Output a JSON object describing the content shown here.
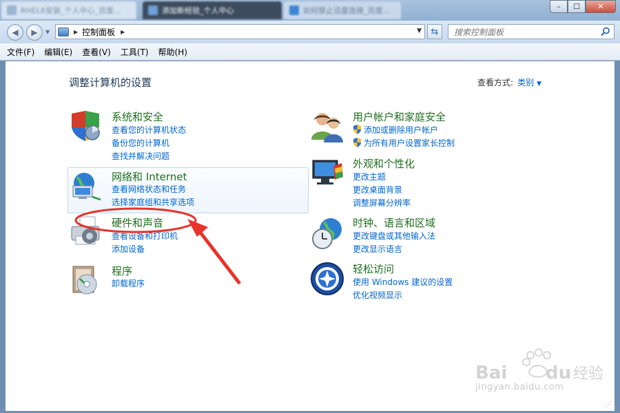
{
  "tabs": [
    {
      "label": "RHEL6安装_个人中心_百度..."
    },
    {
      "label": "添加新经验_个人中心"
    },
    {
      "label": "如何禁止迅雷连接_百度..."
    }
  ],
  "window": {
    "min": "–",
    "max": "☐",
    "close": "✕"
  },
  "address": {
    "crumb": "控制面板",
    "search_placeholder": "搜索控制面板"
  },
  "menu": [
    "文件(F)",
    "编辑(E)",
    "查看(V)",
    "工具(T)",
    "帮助(H)"
  ],
  "main": {
    "title": "调整计算机的设置",
    "view_by_label": "查看方式:",
    "view_by_value": "类别"
  },
  "categories": [
    {
      "title": "系统和安全",
      "links": [
        "查看您的计算机状态",
        "备份您的计算机",
        "查找并解决问题"
      ],
      "icon": "shield-icon"
    },
    {
      "title": "网络和 Internet",
      "links": [
        "查看网络状态和任务",
        "选择家庭组和共享选项"
      ],
      "icon": "network-icon"
    },
    {
      "title": "硬件和声音",
      "links": [
        "查看设备和打印机",
        "添加设备"
      ],
      "icon": "printer-icon"
    },
    {
      "title": "程序",
      "links": [
        "卸载程序"
      ],
      "icon": "programs-icon"
    },
    {
      "title": "用户帐户和家庭安全",
      "links": [
        "添加或删除用户帐户",
        "为所有用户设置家长控制"
      ],
      "icon": "users-icon"
    },
    {
      "title": "外观和个性化",
      "links": [
        "更改主题",
        "更改桌面背景",
        "调整屏幕分辨率"
      ],
      "icon": "appearance-icon"
    },
    {
      "title": "时钟、语言和区域",
      "links": [
        "更改键盘或其他输入法",
        "更改显示语言"
      ],
      "icon": "clock-globe-icon"
    },
    {
      "title": "轻松访问",
      "links": [
        "使用 Windows 建议的设置",
        "优化视频显示"
      ],
      "icon": "ease-of-access-icon"
    }
  ],
  "watermark": {
    "text": "jingyan.baidu.com",
    "logo": "Baidu经验"
  }
}
